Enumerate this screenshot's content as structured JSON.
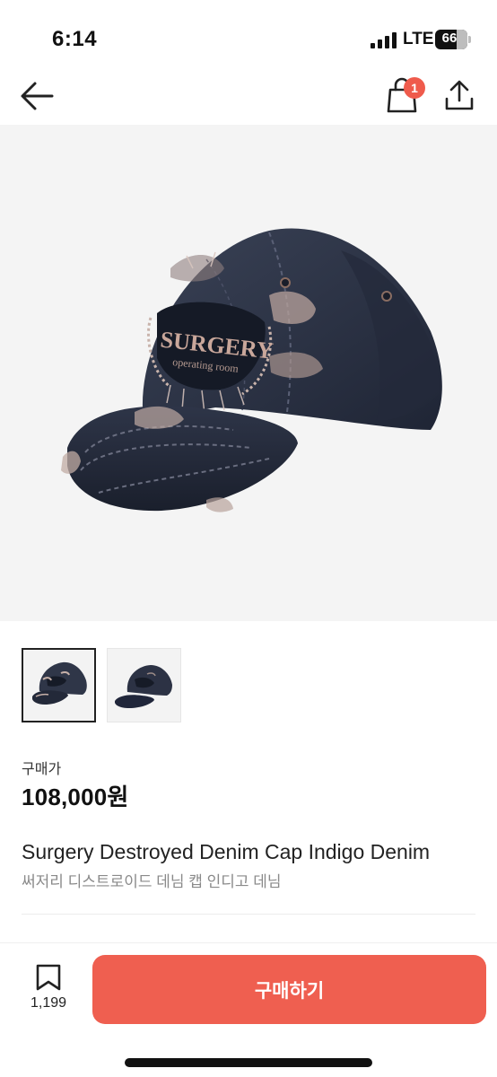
{
  "status_bar": {
    "time": "6:14",
    "network": "LTE",
    "battery_level": "66",
    "battery_fraction": 0.66
  },
  "nav": {
    "back_icon": "arrow-left-icon",
    "cart_icon": "shopping-bag-icon",
    "cart_badge": "1",
    "share_icon": "share-upload-icon"
  },
  "product": {
    "image_alt_icon": "denim-cap-photo",
    "thumbnails": [
      {
        "icon": "denim-cap-thumbnail",
        "selected": true
      },
      {
        "icon": "denim-cap-thumbnail",
        "selected": false
      }
    ],
    "cap_brand_text": "SURGERY",
    "cap_sub_text": "operating room",
    "price_label": "구매가",
    "price": "108,000원",
    "title_en": "Surgery Destroyed Denim Cap Indigo Denim",
    "title_ko": "써저리 디스트로이드 데님 캡 인디고 데님"
  },
  "bottom_bar": {
    "wish_icon": "bookmark-icon",
    "wish_count": "1,199",
    "buy_label": "구매하기"
  },
  "colors": {
    "accent": "#ef5f50",
    "badge": "#ef5b4c",
    "denim": "#2b3345"
  }
}
